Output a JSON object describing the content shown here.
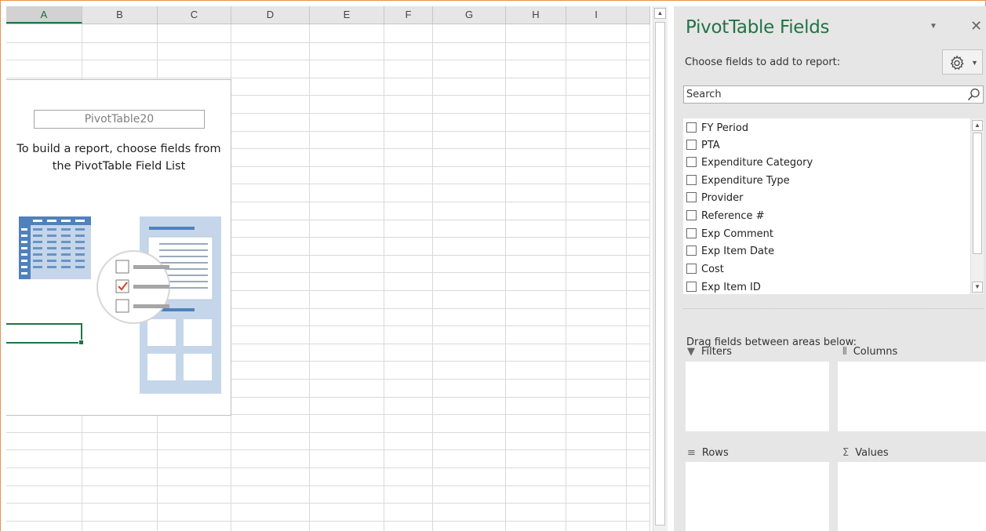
{
  "sheet": {
    "columns": [
      {
        "label": "A",
        "width": 97
      },
      {
        "label": "B",
        "width": 96
      },
      {
        "label": "C",
        "width": 94
      },
      {
        "label": "D",
        "width": 100
      },
      {
        "label": "E",
        "width": 95
      },
      {
        "label": "F",
        "width": 62
      },
      {
        "label": "G",
        "width": 93
      },
      {
        "label": "H",
        "width": 77
      },
      {
        "label": "I",
        "width": 77
      },
      {
        "label": "",
        "width": 30
      }
    ],
    "active_column": "A",
    "pivot_placeholder": {
      "name": "PivotTable20",
      "hint_line1": "To build a report, choose fields from",
      "hint_line2": "the PivotTable Field List"
    }
  },
  "pane": {
    "title": "PivotTable Fields",
    "choose_label": "Choose fields to add to report:",
    "search_placeholder": "Search",
    "fields": [
      "FY Period",
      "PTA",
      "Expenditure Category",
      "Expenditure Type",
      "Provider",
      "Reference #",
      "Exp Comment",
      "Exp Item Date",
      "Cost",
      "Exp Item ID"
    ],
    "drag_label": "Drag fields between areas below:",
    "areas": {
      "filters": "Filters",
      "columns": "Columns",
      "rows": "Rows",
      "values": "Values"
    },
    "icons": {
      "filters": "filter-icon",
      "columns": "columns-icon",
      "rows": "rows-icon",
      "values": "sigma-icon"
    }
  },
  "colors": {
    "accent": "#217346",
    "pane_bg": "#e6e6e6",
    "illustration_blue": "#4f81bd"
  }
}
